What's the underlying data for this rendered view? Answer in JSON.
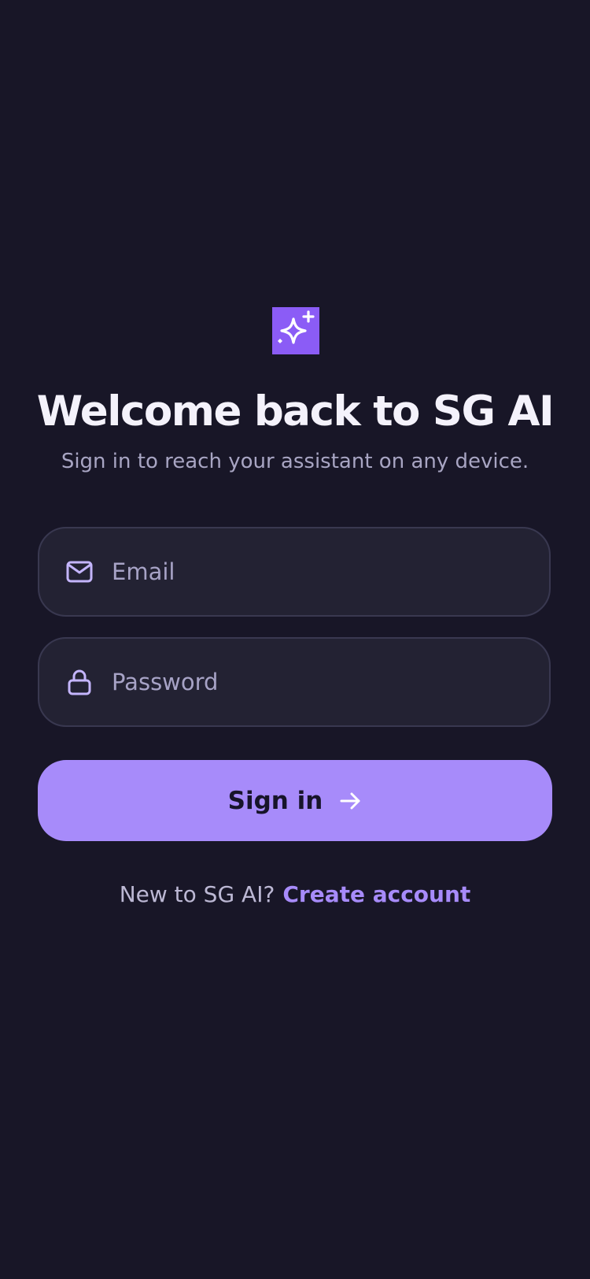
{
  "app": {
    "name": "SG AI"
  },
  "header": {
    "logo_icon": "sparkles-icon",
    "title": "Welcome back to SG AI",
    "subtitle": "Sign in to reach your assistant on any device."
  },
  "form": {
    "email": {
      "icon": "mail-icon",
      "placeholder": "Email",
      "value": ""
    },
    "password": {
      "icon": "lock-icon",
      "placeholder": "Password",
      "value": ""
    },
    "signin_label": "Sign in",
    "signin_icon": "arrow-right-icon"
  },
  "footer": {
    "prompt": "New to SG AI?",
    "link_label": "Create account"
  },
  "colors": {
    "background": "#181627",
    "accent": "#a78bfa",
    "logo_bg": "#8b5cf6",
    "field_bg": "#232233",
    "field_border": "#393850"
  }
}
